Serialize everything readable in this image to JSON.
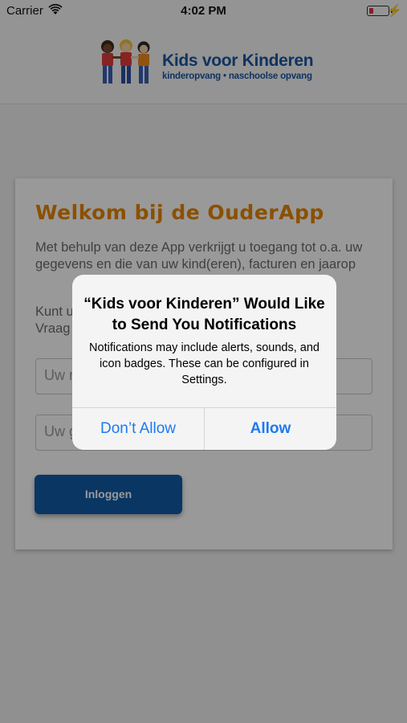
{
  "status_bar": {
    "carrier": "Carrier",
    "time": "4:02 PM",
    "battery_color": "#e0323e"
  },
  "header": {
    "brand_name": "Kids voor Kinderen",
    "brand_subtitle": "kinderopvang • naschoolse opvang",
    "brand_color": "#1a56a0"
  },
  "card": {
    "title": "Welkom bij de OuderApp",
    "title_color": "#e88500",
    "paragraph1": "Met behulp van deze App verkrijgt u toegang tot o.a. uw gegevens en die van uw kind(eren), facturen en jaarop",
    "paragraph2": "Kunt u\nVraag",
    "username_placeholder": "Uw r",
    "password_placeholder": "Uw g",
    "login_label": "Inloggen",
    "login_color": "#0f5aa6"
  },
  "alert": {
    "title": "“Kids voor Kinderen” Would Like to Send You Notifications",
    "message": "Notifications may include alerts, sounds, and icon badges. These can be configured in Settings.",
    "dont_allow_label": "Don’t Allow",
    "allow_label": "Allow",
    "button_color": "#1c7af2"
  }
}
